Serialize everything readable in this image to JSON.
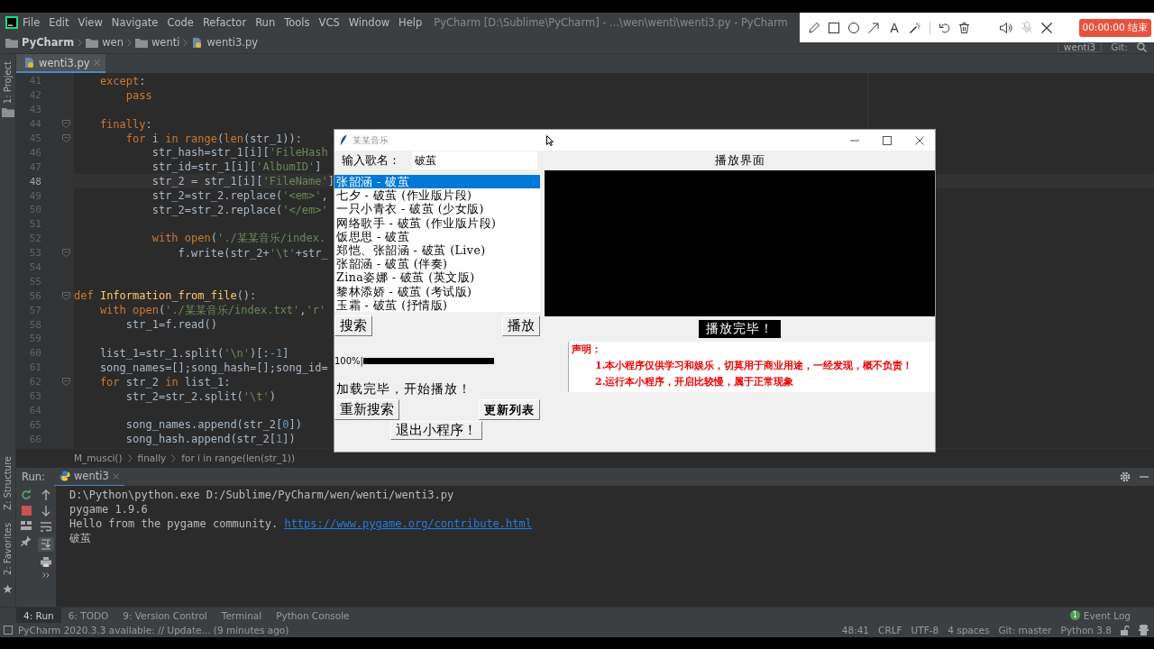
{
  "menu_bar": {
    "items": [
      "File",
      "Edit",
      "View",
      "Navigate",
      "Code",
      "Refactor",
      "Run",
      "Tools",
      "VCS",
      "Window",
      "Help"
    ],
    "title": "PyCharm [D:\\Sublime\\PyCharm] - ...\\wen\\wenti\\wenti3.py - PyCharm"
  },
  "navigation_bar": {
    "crumbs": [
      "PyCharm",
      "wen",
      "wenti",
      "wenti3.py"
    ],
    "run_config": "wenti3",
    "git_label": "Git:"
  },
  "left_strip": {
    "top": [
      "1: Project"
    ],
    "bottom": [
      "Z: Structure",
      "2: Favorites"
    ]
  },
  "editor_tab": {
    "label": "wenti3.py"
  },
  "code_lines": [
    {
      "number": "41",
      "fold": false,
      "current": false,
      "code": [
        {
          "kind": "kw",
          "text": "    except"
        },
        {
          "kind": "plain",
          "text": ":"
        }
      ]
    },
    {
      "number": "42",
      "fold": false,
      "current": false,
      "code": [
        {
          "kind": "kw",
          "text": "        pass"
        }
      ]
    },
    {
      "number": "43",
      "fold": false,
      "current": false
    },
    {
      "number": "44",
      "fold": true,
      "current": false,
      "code": [
        {
          "kind": "kw",
          "text": "    finally"
        },
        {
          "kind": "plain",
          "text": ":"
        }
      ]
    },
    {
      "number": "45",
      "fold": true,
      "current": false,
      "code": [
        {
          "kind": "kw",
          "text": "        for"
        },
        {
          "kind": "plain",
          "text": " i "
        },
        {
          "kind": "kw",
          "text": "in"
        },
        {
          "kind": "kw",
          "text": " range"
        },
        {
          "kind": "plain",
          "text": "("
        },
        {
          "kind": "kw",
          "text": "len"
        },
        {
          "kind": "plain",
          "text": "(str_1)):"
        }
      ]
    },
    {
      "number": "46",
      "fold": false,
      "current": false,
      "code": [
        {
          "kind": "plain",
          "text": "            str_hash=str_1[i]["
        },
        {
          "kind": "str",
          "text": "'FileHash"
        }
      ]
    },
    {
      "number": "47",
      "fold": false,
      "current": false,
      "code": [
        {
          "kind": "plain",
          "text": "            str_id=str_1[i]["
        },
        {
          "kind": "str",
          "text": "'AlbumID'"
        },
        {
          "kind": "plain",
          "text": "]"
        }
      ]
    },
    {
      "number": "48",
      "fold": false,
      "current": true,
      "code": [
        {
          "kind": "plain",
          "text": "            str_2 = str_1[i]["
        },
        {
          "kind": "str",
          "text": "'FileName'"
        },
        {
          "kind": "plain",
          "text": "]"
        }
      ]
    },
    {
      "number": "49",
      "fold": false,
      "current": false,
      "code": [
        {
          "kind": "plain",
          "text": "            str_2=str_2.replace("
        },
        {
          "kind": "str",
          "text": "'<em>'"
        },
        {
          "kind": "plain",
          "text": ","
        }
      ]
    },
    {
      "number": "50",
      "fold": false,
      "current": false,
      "code": [
        {
          "kind": "plain",
          "text": "            str_2=str_2.replace("
        },
        {
          "kind": "str",
          "text": "'</em>'"
        }
      ]
    },
    {
      "number": "51",
      "fold": false,
      "current": false
    },
    {
      "number": "52",
      "fold": false,
      "current": false,
      "code": [
        {
          "kind": "kw",
          "text": "            with open"
        },
        {
          "kind": "plain",
          "text": "("
        },
        {
          "kind": "str",
          "text": "'./某某音乐/index."
        }
      ]
    },
    {
      "number": "53",
      "fold": true,
      "current": false,
      "code": [
        {
          "kind": "plain",
          "text": "                f.write(str_2+"
        },
        {
          "kind": "str",
          "text": "'\\t'"
        },
        {
          "kind": "plain",
          "text": "+str_"
        }
      ]
    },
    {
      "number": "54",
      "fold": false,
      "current": false
    },
    {
      "number": "55",
      "fold": false,
      "current": false
    },
    {
      "number": "56",
      "fold": true,
      "current": false,
      "code": [
        {
          "kind": "kw",
          "text": "def"
        },
        {
          "kind": "fn",
          "text": " Information_from_file"
        },
        {
          "kind": "plain",
          "text": "():"
        }
      ]
    },
    {
      "number": "57",
      "fold": false,
      "current": false,
      "code": [
        {
          "kind": "kw",
          "text": "    with open"
        },
        {
          "kind": "plain",
          "text": "("
        },
        {
          "kind": "str",
          "text": "'./某某音乐/index.txt'"
        },
        {
          "kind": "plain",
          "text": ","
        },
        {
          "kind": "str",
          "text": "'r'"
        }
      ]
    },
    {
      "number": "58",
      "fold": false,
      "current": false,
      "code": [
        {
          "kind": "plain",
          "text": "        str_1=f.read()"
        }
      ]
    },
    {
      "number": "59",
      "fold": false,
      "current": false
    },
    {
      "number": "60",
      "fold": false,
      "current": false,
      "code": [
        {
          "kind": "plain",
          "text": "    list_1=str_1.split("
        },
        {
          "kind": "str",
          "text": "'\\n'"
        },
        {
          "kind": "plain",
          "text": ")[:"
        },
        {
          "kind": "num",
          "text": "-1"
        },
        {
          "kind": "plain",
          "text": "]"
        }
      ]
    },
    {
      "number": "61",
      "fold": false,
      "current": false,
      "code": [
        {
          "kind": "plain",
          "text": "    song_names=[];song_hash=[];song_id="
        }
      ]
    },
    {
      "number": "62",
      "fold": true,
      "current": false,
      "code": [
        {
          "kind": "kw",
          "text": "    for"
        },
        {
          "kind": "plain",
          "text": " str_2 "
        },
        {
          "kind": "kw",
          "text": "in"
        },
        {
          "kind": "plain",
          "text": " list_1:"
        }
      ]
    },
    {
      "number": "63",
      "fold": false,
      "current": false,
      "code": [
        {
          "kind": "plain",
          "text": "        str_2=str_2.split("
        },
        {
          "kind": "str",
          "text": "'\\t'"
        },
        {
          "kind": "plain",
          "text": ")"
        }
      ]
    },
    {
      "number": "64",
      "fold": false,
      "current": false
    },
    {
      "number": "65",
      "fold": false,
      "current": false,
      "code": [
        {
          "kind": "plain",
          "text": "        song_names.append(str_2["
        },
        {
          "kind": "num",
          "text": "0"
        },
        {
          "kind": "plain",
          "text": "])"
        }
      ]
    },
    {
      "number": "66",
      "fold": false,
      "current": false,
      "code": [
        {
          "kind": "plain",
          "text": "        song_hash.append(str_2["
        },
        {
          "kind": "num",
          "text": "1"
        },
        {
          "kind": "plain",
          "text": "])"
        }
      ]
    }
  ],
  "breadcrumbs": [
    "M_musci()",
    "finally",
    "for i in range(len(str_1))"
  ],
  "run_panel": {
    "label": "Run:",
    "tab": "wenti3",
    "output": [
      {
        "text": "D:\\Python\\python.exe D:/Sublime/PyCharm/wen/wenti/wenti3.py"
      },
      {
        "text": "pygame 1.9.6"
      },
      {
        "text": "Hello from the pygame community. ",
        "link": "https://www.pygame.org/contribute.html"
      },
      {
        "text": "破茧"
      }
    ]
  },
  "tool_windows": [
    {
      "label": "4: Run",
      "selected": true
    },
    {
      "label": "6: TODO",
      "selected": false
    },
    {
      "label": "9: Version Control",
      "selected": false
    },
    {
      "label": "Terminal",
      "selected": false
    },
    {
      "label": "Python Console",
      "selected": false
    }
  ],
  "event_log": {
    "badge": "1",
    "label": "Event Log"
  },
  "status_bar": {
    "message": "PyCharm 2020.3.3 available: // Update... (9 minutes ago)",
    "items": [
      "48:41",
      "CRLF",
      "UTF-8",
      "4 spaces",
      "Git: master",
      "Python 3.8"
    ]
  },
  "app_window": {
    "title": "某某音乐",
    "song_label": "输入歌名：",
    "song_input": "破茧",
    "songs": [
      {
        "text": "张韶涵 - 破茧",
        "selected": true
      },
      {
        "text": "七夕 - 破茧 (作业版片段)",
        "selected": false
      },
      {
        "text": "一只小青衣 - 破茧 (少女版)",
        "selected": false
      },
      {
        "text": "网络歌手 - 破茧 (作业版片段)",
        "selected": false
      },
      {
        "text": "饭思思 - 破茧",
        "selected": false
      },
      {
        "text": "郑恺、张韶涵 - 破茧 (Live)",
        "selected": false
      },
      {
        "text": "张韶涵 - 破茧 (伴奏)",
        "selected": false
      },
      {
        "text": "Zina姿娜 - 破茧 (英文版)",
        "selected": false
      },
      {
        "text": "黎林添娇 - 破茧 (考试版)",
        "selected": false
      },
      {
        "text": "玉霜 - 破茧 (抒情版)",
        "selected": false
      }
    ],
    "search_button": "搜索",
    "play_button": "播放",
    "progress": {
      "label": "100%|",
      "level": 1
    },
    "status_text": "加载完毕，开始播放！",
    "research_button": "重新搜索",
    "refresh_button": "更新列表",
    "quit_button": "退出小程序！",
    "player_title": "播放界面",
    "player_status": "播放完毕！",
    "notice": [
      "声明：",
      "1.本小程序仅供学习和娱乐，切莫用于商业用途，一经发现，概不负责！",
      "2.运行本小程序，开启比较慢，属于正常现象"
    ]
  },
  "recorder_toolbar": {
    "text_tool": "A",
    "timer": "00:00:00 结束"
  }
}
